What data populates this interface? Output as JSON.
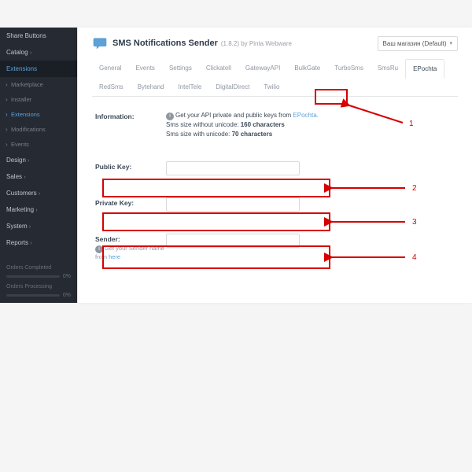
{
  "sidebar": {
    "items": [
      {
        "label": "Share Buttons"
      },
      {
        "label": "Catalog"
      },
      {
        "label": "Extensions"
      },
      {
        "label": "Design"
      },
      {
        "label": "Sales"
      },
      {
        "label": "Customers"
      },
      {
        "label": "Marketing"
      },
      {
        "label": "System"
      },
      {
        "label": "Reports"
      }
    ],
    "subs": [
      {
        "label": "Marketplace"
      },
      {
        "label": "Installer"
      },
      {
        "label": "Extensions"
      },
      {
        "label": "Modifications"
      },
      {
        "label": "Events"
      }
    ],
    "footer": {
      "row1_label": "Orders Completed",
      "row1_pct": "0%",
      "row1_fill": 0,
      "row2_label": "Orders Processing",
      "row2_pct": "0%",
      "row2_fill": 0
    }
  },
  "header": {
    "title": "SMS Notifications Sender",
    "subtitle": "(1.8.2) by Pinta Webware",
    "store_select": "Ваш магазин (Default)"
  },
  "tabs": [
    "General",
    "Events",
    "Settings",
    "Clickatell",
    "GatewayAPI",
    "BulkGate",
    "TurboSms",
    "SmsRu",
    "EPochta",
    "RedSms",
    "Bytehand",
    "IntelTele",
    "DigitalDirect",
    "Twilio"
  ],
  "active_tab": "EPochta",
  "form": {
    "info_label": "Information:",
    "info_text1": "Get your API private and public keys from ",
    "info_link1": "EPochta.",
    "info_text2": "Sms size without unicode: ",
    "info_val2": "160 characters",
    "info_text3": "Sms size with unicode: ",
    "info_val3": "70 characters",
    "public_key_label": "Public Key:",
    "private_key_label": "Private Key:",
    "sender_label": "Sender:",
    "sender_hint_prefix": "Get your Sender name from ",
    "sender_hint_link": "here"
  },
  "annotations": {
    "n1": "1",
    "n2": "2",
    "n3": "3",
    "n4": "4"
  }
}
